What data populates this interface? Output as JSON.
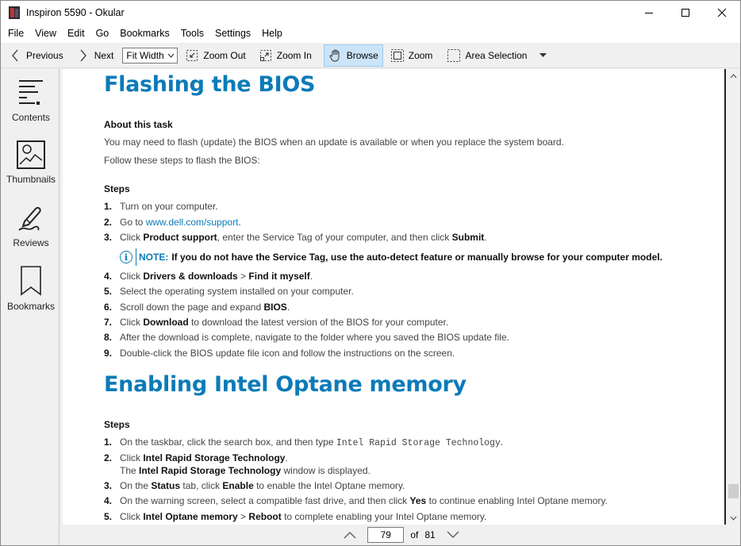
{
  "window": {
    "title": "Inspiron 5590  - Okular",
    "controls": [
      "minimize",
      "maximize",
      "close"
    ]
  },
  "menubar": {
    "items": [
      "File",
      "View",
      "Edit",
      "Go",
      "Bookmarks",
      "Tools",
      "Settings",
      "Help"
    ]
  },
  "toolbar": {
    "previous_label": "Previous",
    "next_label": "Next",
    "zoom_mode": "Fit Width",
    "zoom_out_label": "Zoom Out",
    "zoom_in_label": "Zoom In",
    "browse_label": "Browse",
    "zoom_label": "Zoom",
    "area_selection_label": "Area Selection",
    "active_tool": "Browse"
  },
  "sidebar": {
    "items": [
      {
        "label": "Contents",
        "icon": "contents-icon"
      },
      {
        "label": "Thumbnails",
        "icon": "thumbnails-icon"
      },
      {
        "label": "Reviews",
        "icon": "reviews-icon"
      },
      {
        "label": "Bookmarks",
        "icon": "bookmarks-icon"
      }
    ]
  },
  "document": {
    "section1": {
      "title": "Flashing the BIOS",
      "about_heading": "About this task",
      "about_text": "You may need to flash (update) the BIOS when an update is available or when you replace the system board.",
      "follow_text": "Follow these steps to flash the BIOS:",
      "steps_heading": "Steps",
      "steps": [
        {
          "num": "1.",
          "parts": [
            {
              "t": "Turn on your computer."
            }
          ]
        },
        {
          "num": "2.",
          "parts": [
            {
              "t": "Go to "
            },
            {
              "link": "www.dell.com/support"
            },
            {
              "t": "."
            }
          ]
        },
        {
          "num": "3.",
          "parts": [
            {
              "t": "Click "
            },
            {
              "b": "Product support"
            },
            {
              "t": ", enter the Service Tag of your computer, and then click "
            },
            {
              "b": "Submit"
            },
            {
              "t": "."
            }
          ]
        },
        {
          "num": "4.",
          "parts": [
            {
              "t": "Click "
            },
            {
              "b": "Drivers & downloads"
            },
            {
              "t": " > "
            },
            {
              "b": "Find it myself"
            },
            {
              "t": "."
            }
          ]
        },
        {
          "num": "5.",
          "parts": [
            {
              "t": "Select the operating system installed on your computer."
            }
          ]
        },
        {
          "num": "6.",
          "parts": [
            {
              "t": "Scroll down the page and expand "
            },
            {
              "b": "BIOS"
            },
            {
              "t": "."
            }
          ]
        },
        {
          "num": "7.",
          "parts": [
            {
              "t": "Click "
            },
            {
              "b": "Download"
            },
            {
              "t": " to download the latest version of the BIOS for your computer."
            }
          ]
        },
        {
          "num": "8.",
          "parts": [
            {
              "t": "After the download is complete, navigate to the folder where you saved the BIOS update file."
            }
          ]
        },
        {
          "num": "9.",
          "parts": [
            {
              "t": "Double-click the BIOS update file icon and follow the instructions on the screen."
            }
          ]
        }
      ],
      "note_label": "NOTE:",
      "note_text": "If you do not have the Service Tag, use the auto-detect feature or manually browse for your computer model."
    },
    "section2": {
      "title": "Enabling Intel Optane memory",
      "steps_heading": "Steps",
      "steps": [
        {
          "num": "1.",
          "parts": [
            {
              "t": "On the taskbar, click the search box, and then type "
            },
            {
              "m": "Intel Rapid Storage Technology"
            },
            {
              "t": "."
            }
          ]
        },
        {
          "num": "2.",
          "parts": [
            {
              "t": "Click "
            },
            {
              "b": "Intel Rapid Storage Technology"
            },
            {
              "t": "."
            }
          ],
          "cont": [
            {
              "t": "The "
            },
            {
              "b": "Intel Rapid Storage Technology"
            },
            {
              "t": " window is displayed."
            }
          ]
        },
        {
          "num": "3.",
          "parts": [
            {
              "t": "On the "
            },
            {
              "b": "Status"
            },
            {
              "t": " tab, click "
            },
            {
              "b": "Enable"
            },
            {
              "t": " to enable the Intel Optane memory."
            }
          ]
        },
        {
          "num": "4.",
          "parts": [
            {
              "t": "On the warning screen, select a compatible fast drive, and then click "
            },
            {
              "b": "Yes"
            },
            {
              "t": " to continue enabling Intel Optane memory."
            }
          ]
        },
        {
          "num": "5.",
          "parts": [
            {
              "t": "Click "
            },
            {
              "b": "Intel Optane memory"
            },
            {
              "t": " > "
            },
            {
              "b": "Reboot"
            },
            {
              "t": " to complete enabling your Intel Optane memory."
            }
          ]
        }
      ]
    }
  },
  "pagination": {
    "current_page": "79",
    "of_label": "of",
    "total_pages": "81"
  },
  "scrollbar": {
    "position_fraction": 0.97
  },
  "colors": {
    "heading_blue": "#0b7bb8",
    "active_tool_bg": "#cce4f7"
  }
}
